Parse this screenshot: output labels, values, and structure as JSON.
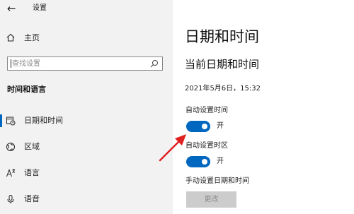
{
  "window": {
    "title": "设置"
  },
  "sidebar": {
    "home_label": "主页",
    "search_placeholder": "查找设置",
    "section_heading": "时间和语言",
    "items": [
      {
        "label": "日期和时间",
        "icon": "calendar-clock-icon",
        "active": true
      },
      {
        "label": "区域",
        "icon": "region-globe-icon"
      },
      {
        "label": "语言",
        "icon": "language-icon"
      },
      {
        "label": "语音",
        "icon": "microphone-icon"
      }
    ]
  },
  "main": {
    "title": "日期和时间",
    "subtitle": "当前日期和时间",
    "current_datetime": "2021年5月6日，15:32",
    "auto_time": {
      "label": "自动设置时间",
      "state": "开",
      "on": true
    },
    "auto_timezone": {
      "label": "自动设置时区",
      "state": "开",
      "on": true
    },
    "manual": {
      "label": "手动设置日期和时间",
      "button": "更改"
    }
  },
  "colors": {
    "accent": "#0067c0",
    "sidebar_bg": "#f2f2f2",
    "annotation": "#e02020"
  }
}
